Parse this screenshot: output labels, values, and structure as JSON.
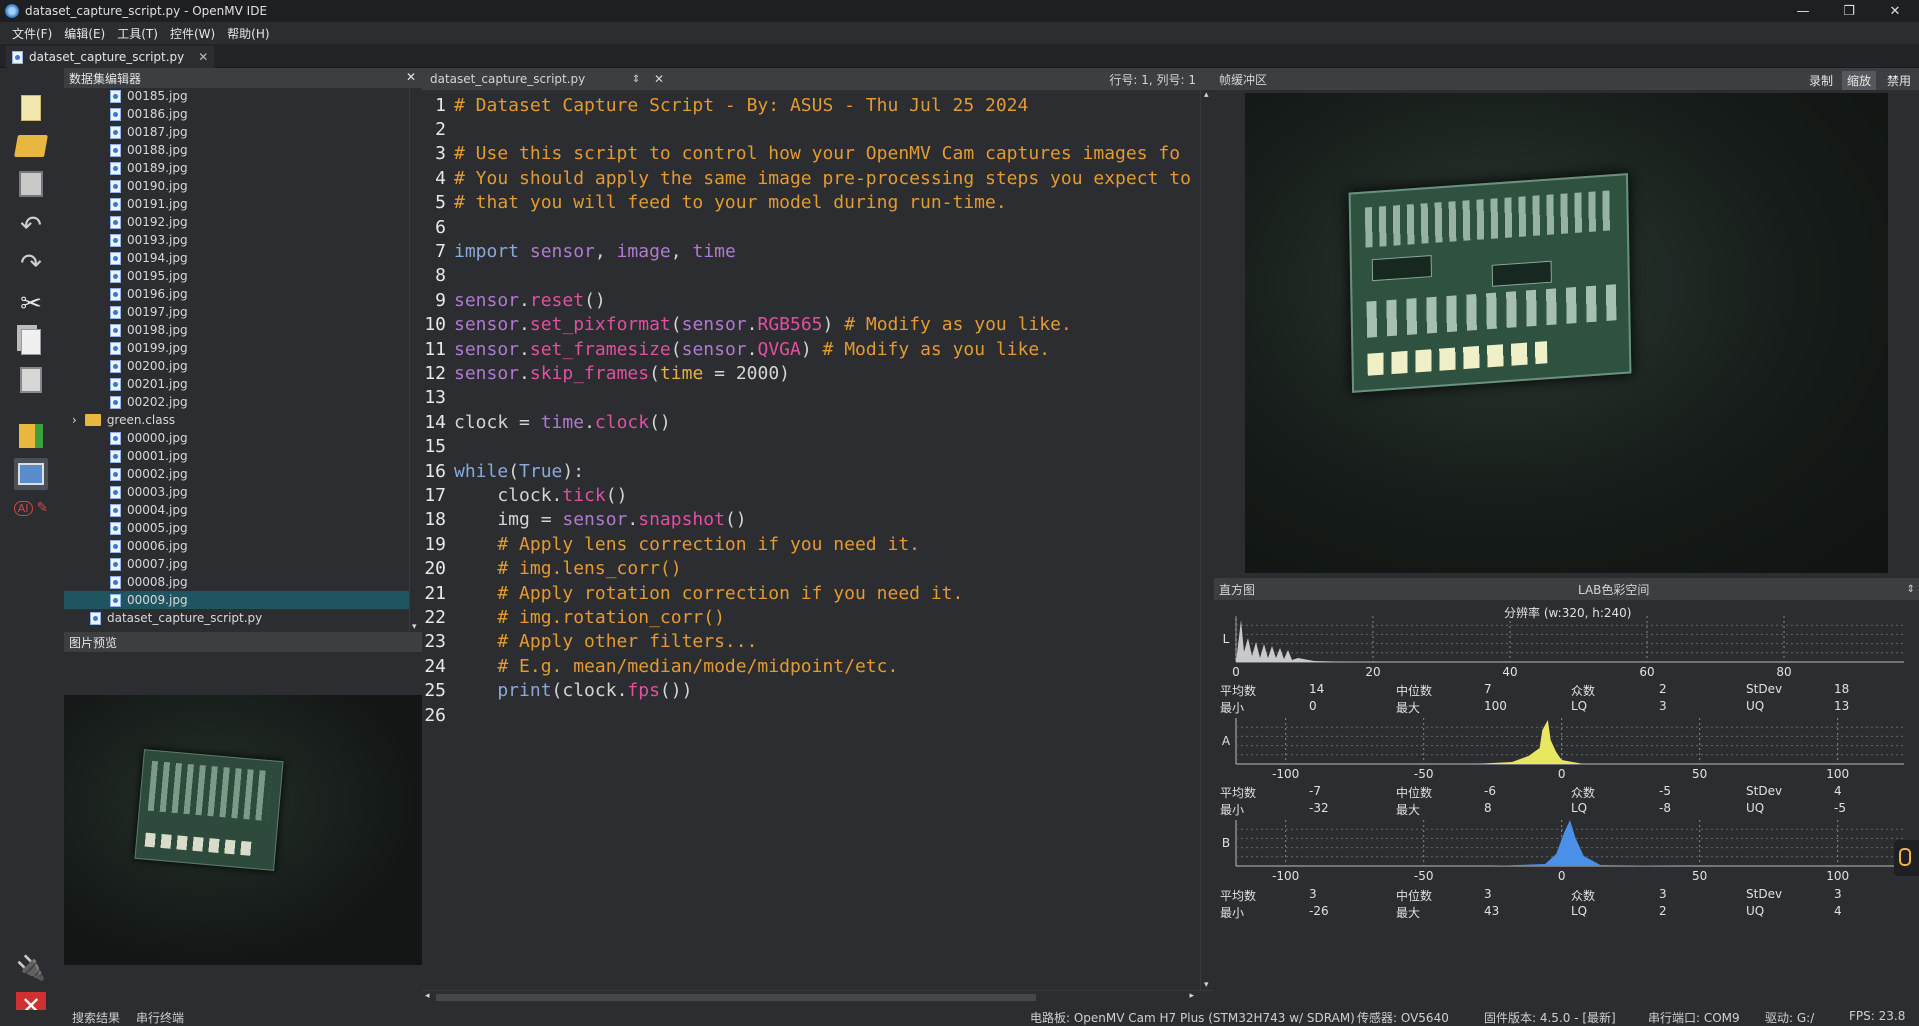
{
  "window": {
    "title": "dataset_capture_script.py - OpenMV IDE"
  },
  "menu": [
    "文件(F)",
    "编辑(E)",
    "工具(T)",
    "控件(W)",
    "帮助(H)"
  ],
  "doc_tab": {
    "label": "dataset_capture_script.py"
  },
  "dataset_editor": {
    "title": "数据集编辑器",
    "files_a": [
      "00185.jpg",
      "00186.jpg",
      "00187.jpg",
      "00188.jpg",
      "00189.jpg",
      "00190.jpg",
      "00191.jpg",
      "00192.jpg",
      "00193.jpg",
      "00194.jpg",
      "00195.jpg",
      "00196.jpg",
      "00197.jpg",
      "00198.jpg",
      "00199.jpg",
      "00200.jpg",
      "00201.jpg",
      "00202.jpg"
    ],
    "folder": "green.class",
    "files_b": [
      "00000.jpg",
      "00001.jpg",
      "00002.jpg",
      "00003.jpg",
      "00004.jpg",
      "00005.jpg",
      "00006.jpg",
      "00007.jpg",
      "00008.jpg",
      "00009.jpg"
    ],
    "script_file": "dataset_capture_script.py",
    "selected": "00009.jpg"
  },
  "image_preview": {
    "title": "图片预览"
  },
  "editor": {
    "file_select": "dataset_capture_script.py",
    "position": "行号: 1, 列号: 1"
  },
  "framebuffer": {
    "title": "帧缓冲区",
    "record": "录制",
    "zoom": "缩放",
    "disable": "禁用"
  },
  "histogram": {
    "title": "直方图",
    "colorspace": "LAB色彩空间",
    "resolution": "分辨率 (w:320, h:240)",
    "l_ticks": [
      "0",
      "20",
      "40",
      "60",
      "80"
    ],
    "ab_ticks": [
      "-100",
      "-50",
      "0",
      "50",
      "100"
    ],
    "labels": {
      "mean": "平均数",
      "median": "中位数",
      "mode": "众数",
      "stdev": "StDev",
      "min": "最小",
      "max": "最大",
      "lq": "LQ",
      "uq": "UQ"
    },
    "L": {
      "axis": "L",
      "mean": "14",
      "median": "7",
      "mode": "2",
      "stdev": "18",
      "min": "0",
      "max": "100",
      "lq": "3",
      "uq": "13"
    },
    "A": {
      "axis": "A",
      "mean": "-7",
      "median": "-6",
      "mode": "-5",
      "stdev": "4",
      "min": "-32",
      "max": "8",
      "lq": "-8",
      "uq": "-5"
    },
    "B": {
      "axis": "B",
      "mean": "3",
      "median": "3",
      "mode": "3",
      "stdev": "3",
      "min": "-26",
      "max": "43",
      "lq": "2",
      "uq": "4"
    }
  },
  "status": {
    "search_results": "搜索结果",
    "serial_terminal": "串行终端",
    "board": "电路板: OpenMV Cam H7 Plus (STM32H743 w/ SDRAM)",
    "sensor": "传感器: OV5640",
    "firmware": "固件版本: 4.5.0 - [最新]",
    "port": "串行端口: COM9",
    "drive": "驱动: G:/",
    "fps": "FPS: 23.8"
  }
}
